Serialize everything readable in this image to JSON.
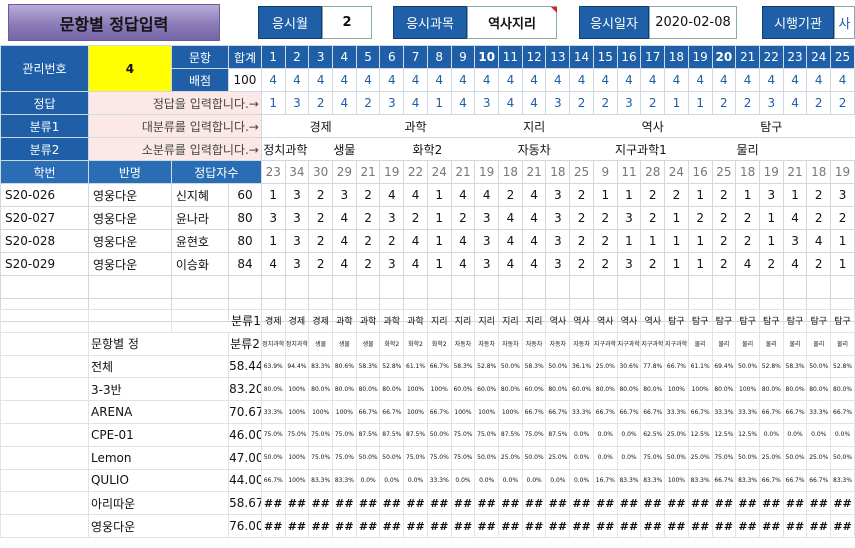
{
  "header": {
    "title": "문항별 정답입력",
    "month_label": "응시월",
    "month_value": "2",
    "subject_label": "응시과목",
    "subject_value": "역사지리",
    "date_label": "응시일자",
    "date_value": "2020-02-08",
    "org_label": "시행기관",
    "org_value": "사"
  },
  "info": {
    "mgmt_label": "관리번호",
    "mgmt_value": "4",
    "q_label": "문항",
    "score_label": "배점",
    "total_label": "합계",
    "total_score": "100",
    "answer_label": "정답",
    "answer_hint": "정답을 입력합니다.→",
    "cat1_label": "분류1",
    "cat1_hint": "대분류를 입력합니다.→",
    "cat2_label": "분류2",
    "cat2_hint": "소분류를 입력합니다.→",
    "col_id": "학번",
    "col_class": "반명",
    "col_answer_count": "정답자수"
  },
  "questions": [
    "1",
    "2",
    "3",
    "4",
    "5",
    "6",
    "7",
    "8",
    "9",
    "10",
    "11",
    "12",
    "13",
    "14",
    "15",
    "16",
    "17",
    "18",
    "19",
    "20",
    "21",
    "22",
    "23",
    "24",
    "25"
  ],
  "scores": [
    "4",
    "4",
    "4",
    "4",
    "4",
    "4",
    "4",
    "4",
    "4",
    "4",
    "4",
    "4",
    "4",
    "4",
    "4",
    "4",
    "4",
    "4",
    "4",
    "4",
    "4",
    "4",
    "4",
    "4",
    "4"
  ],
  "answers": [
    "1",
    "3",
    "2",
    "4",
    "2",
    "3",
    "4",
    "1",
    "4",
    "3",
    "4",
    "4",
    "3",
    "2",
    "2",
    "3",
    "2",
    "1",
    "1",
    "2",
    "2",
    "3",
    "4",
    "2",
    "2"
  ],
  "cat1_row": [
    "",
    "경제",
    "",
    "",
    "",
    "과학",
    "",
    "",
    "",
    "",
    "지리",
    "",
    "",
    "",
    "",
    "역사",
    "",
    "",
    "",
    "",
    "탐구",
    "",
    "",
    ""
  ],
  "cat2_row": [
    "정치과학",
    "",
    "",
    "생물",
    "",
    "",
    "",
    "화학2",
    "",
    "",
    "",
    "",
    "자동차",
    "",
    "",
    "",
    "지구과학1",
    "",
    "",
    "",
    "물리",
    "",
    "",
    ""
  ],
  "correct_counts": [
    "23",
    "34",
    "30",
    "29",
    "21",
    "19",
    "22",
    "24",
    "21",
    "19",
    "18",
    "21",
    "18",
    "25",
    "9",
    "11",
    "28",
    "24",
    "16",
    "25",
    "18",
    "19",
    "21",
    "18",
    "19"
  ],
  "students": [
    {
      "id": "S20-026",
      "cls": "영웅다운",
      "name": "신지혜",
      "score": "60",
      "ans": [
        "1",
        "3",
        "2",
        "3",
        "2",
        "4",
        "4",
        "1",
        "4",
        "4",
        "2",
        "4",
        "3",
        "2",
        "1",
        "1",
        "2",
        "2",
        "1",
        "2",
        "1",
        "3",
        "1",
        "2",
        "3"
      ]
    },
    {
      "id": "S20-027",
      "cls": "영웅다운",
      "name": "윤나라",
      "score": "80",
      "ans": [
        "3",
        "3",
        "2",
        "4",
        "2",
        "3",
        "2",
        "1",
        "2",
        "3",
        "4",
        "4",
        "3",
        "2",
        "2",
        "3",
        "2",
        "1",
        "2",
        "2",
        "2",
        "1",
        "4",
        "2",
        "2"
      ]
    },
    {
      "id": "S20-028",
      "cls": "영웅다운",
      "name": "윤현호",
      "score": "80",
      "ans": [
        "1",
        "3",
        "2",
        "4",
        "2",
        "2",
        "4",
        "1",
        "4",
        "3",
        "4",
        "4",
        "3",
        "2",
        "2",
        "1",
        "1",
        "1",
        "1",
        "2",
        "2",
        "1",
        "3",
        "4",
        "1",
        "2"
      ]
    },
    {
      "id": "S20-029",
      "cls": "영웅다운",
      "name": "이승화",
      "score": "84",
      "ans": [
        "4",
        "3",
        "2",
        "4",
        "2",
        "3",
        "4",
        "1",
        "4",
        "3",
        "4",
        "4",
        "3",
        "2",
        "2",
        "3",
        "2",
        "1",
        "1",
        "2",
        "4",
        "2",
        "4",
        "2",
        "1"
      ]
    }
  ],
  "summary": {
    "cat1_label": "분류1",
    "cat2_label": "분류2",
    "stat_label": "문항별 정",
    "cat1": [
      "경제",
      "경제",
      "경제",
      "과학",
      "과학",
      "과학",
      "과학",
      "지리",
      "지리",
      "지리",
      "지리",
      "지리",
      "역사",
      "역사",
      "역사",
      "역사",
      "역사",
      "탐구",
      "탐구",
      "탐구",
      "탐구",
      "탐구"
    ],
    "cat2": [
      "정치과학",
      "정치과학",
      "생물",
      "생물",
      "생물",
      "화학2",
      "화학2",
      "화학2",
      "자동차",
      "자동차",
      "자동차",
      "자동차",
      "자동차",
      "자동차",
      "지구과학1",
      "지구과학1",
      "지구과학1",
      "지구과학1",
      "물리",
      "물리",
      "물리",
      "물리"
    ],
    "rows": [
      {
        "name": "전체",
        "avg": "58.44",
        "vals": [
          "63.9%",
          "94.4%",
          "83.3%",
          "80.6%",
          "58.3%",
          "52.8%",
          "61.1%",
          "66.7%",
          "58.3%",
          "52.8%",
          "50.0%",
          "58.3%",
          "50.0%",
          "36.1%",
          "25.0%",
          "30.6%",
          "77.8%",
          "66.7%",
          "61.1%",
          "69.4%",
          "50.0%",
          "52.8%",
          "58.3%",
          "50.0%",
          "52.8%"
        ]
      },
      {
        "name": "3-3반",
        "avg": "83.20",
        "vals": [
          "80.0%",
          "100%",
          "80.0%",
          "80.0%",
          "80.0%",
          "80.0%",
          "100%",
          "100%",
          "60.0%",
          "60.0%",
          "80.0%",
          "60.0%",
          "80.0%",
          "60.0%",
          "80.0%",
          "80.0%",
          "80.0%",
          "100%",
          "100%",
          "80.0%",
          "100%",
          "80.0%",
          "80.0%",
          "80.0%",
          "80.0%"
        ]
      },
      {
        "name": "ARENA",
        "avg": "70.67",
        "vals": [
          "33.3%",
          "100%",
          "100%",
          "100%",
          "66.7%",
          "66.7%",
          "100%",
          "66.7%",
          "100%",
          "100%",
          "100%",
          "66.7%",
          "66.7%",
          "33.3%",
          "66.7%",
          "66.7%",
          "66.7%",
          "33.3%",
          "66.7%",
          "33.3%",
          "33.3%",
          "66.7%",
          "66.7%",
          "33.3%",
          "66.7%"
        ]
      },
      {
        "name": "CPE-01",
        "avg": "46.00",
        "vals": [
          "75.0%",
          "75.0%",
          "75.0%",
          "75.0%",
          "87.5%",
          "87.5%",
          "87.5%",
          "50.0%",
          "75.0%",
          "75.0%",
          "87.5%",
          "75.0%",
          "87.5%",
          "0.0%",
          "0.0%",
          "0.0%",
          "62.5%",
          "25.0%",
          "12.5%",
          "12.5%",
          "12.5%",
          "0.0%",
          "0.0%",
          "0.0%",
          "0.0%"
        ]
      },
      {
        "name": "Lemon",
        "avg": "47.00",
        "vals": [
          "50.0%",
          "100%",
          "75.0%",
          "75.0%",
          "50.0%",
          "50.0%",
          "75.0%",
          "75.0%",
          "75.0%",
          "50.0%",
          "25.0%",
          "50.0%",
          "25.0%",
          "0.0%",
          "0.0%",
          "0.0%",
          "75.0%",
          "50.0%",
          "25.0%",
          "75.0%",
          "50.0%",
          "25.0%",
          "50.0%",
          "25.0%",
          "50.0%"
        ]
      },
      {
        "name": "QULIO",
        "avg": "44.00",
        "vals": [
          "66.7%",
          "100%",
          "83.3%",
          "83.3%",
          "0.0%",
          "0.0%",
          "0.0%",
          "33.3%",
          "0.0%",
          "0.0%",
          "0.0%",
          "0.0%",
          "0.0%",
          "0.0%",
          "16.7%",
          "83.3%",
          "83.3%",
          "100%",
          "83.3%",
          "66.7%",
          "83.3%",
          "66.7%",
          "66.7%",
          "66.7%",
          "83.3%"
        ]
      },
      {
        "name": "아리따운",
        "avg": "58.67",
        "vals": [
          "##",
          "##",
          "##",
          "##",
          "##",
          "##",
          "##",
          "##",
          "##",
          "##",
          "##",
          "##",
          "##",
          "##",
          "##",
          "##",
          "##",
          "##",
          "##",
          "##",
          "##",
          "##",
          "##",
          "##",
          "##"
        ]
      },
      {
        "name": "영웅다운",
        "avg": "76.00",
        "vals": [
          "##",
          "##",
          "##",
          "##",
          "##",
          "##",
          "##",
          "##",
          "##",
          "##",
          "##",
          "##",
          "##",
          "##",
          "##",
          "##",
          "##",
          "##",
          "##",
          "##",
          "##",
          "##",
          "##",
          "##",
          "##"
        ]
      }
    ]
  }
}
